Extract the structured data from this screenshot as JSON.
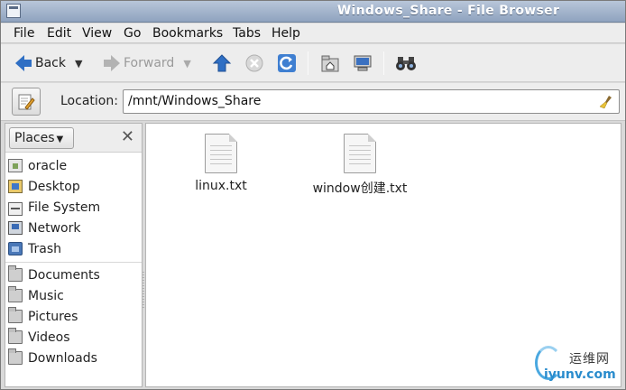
{
  "window": {
    "title": "Windows_Share - File Browser"
  },
  "menu": [
    "File",
    "Edit",
    "View",
    "Go",
    "Bookmarks",
    "Tabs",
    "Help"
  ],
  "toolbar": {
    "back_label": "Back",
    "forward_label": "Forward"
  },
  "location": {
    "label": "Location:",
    "value": "/mnt/Windows_Share"
  },
  "sidebar": {
    "selector_label": "Places",
    "places": [
      {
        "label": "oracle",
        "icon": "home-icon"
      },
      {
        "label": "Desktop",
        "icon": "desktop-icon"
      },
      {
        "label": "File System",
        "icon": "drive-icon"
      },
      {
        "label": "Network",
        "icon": "network-icon"
      },
      {
        "label": "Trash",
        "icon": "trash-icon"
      }
    ],
    "bookmarks": [
      {
        "label": "Documents",
        "icon": "folder-icon"
      },
      {
        "label": "Music",
        "icon": "folder-icon"
      },
      {
        "label": "Pictures",
        "icon": "folder-icon"
      },
      {
        "label": "Videos",
        "icon": "folder-icon"
      },
      {
        "label": "Downloads",
        "icon": "folder-icon"
      }
    ]
  },
  "files": [
    {
      "name": "linux.txt",
      "icon": "text-file-icon"
    },
    {
      "name": "window创建.txt",
      "icon": "text-file-icon"
    }
  ],
  "watermark": {
    "brand": "运维网",
    "url": "iyunv.com"
  }
}
